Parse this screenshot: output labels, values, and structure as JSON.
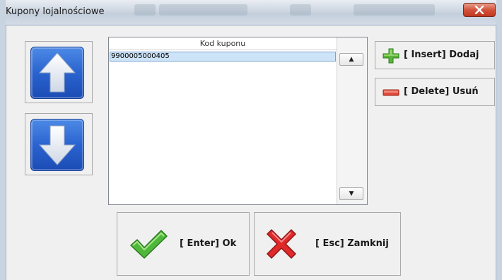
{
  "window": {
    "title": "Kupony lojalnościowe"
  },
  "coupon_list": {
    "header": "Kod kuponu",
    "rows": [
      "9900005000405"
    ],
    "scroll_up_glyph": "▲",
    "scroll_down_glyph": "▼"
  },
  "buttons": {
    "insert_label": "[ Insert] Dodaj",
    "delete_label": "[ Delete] Usuń",
    "ok_label": "[ Enter] Ok",
    "close_label": "[ Esc] Zamknij"
  },
  "icons": {
    "move_up": "arrow-up-icon",
    "move_down": "arrow-down-icon",
    "insert": "plus-icon",
    "delete": "minus-icon",
    "ok": "checkmark-icon",
    "close": "cross-icon",
    "window_close": "close-icon"
  },
  "colors": {
    "tile_blue": "#2a63cf",
    "plus_green": "#5bb53a",
    "minus_red": "#e04a3a",
    "check_green": "#4fb83a",
    "cross_red": "#e02a2a",
    "selection": "#cde3f7"
  }
}
